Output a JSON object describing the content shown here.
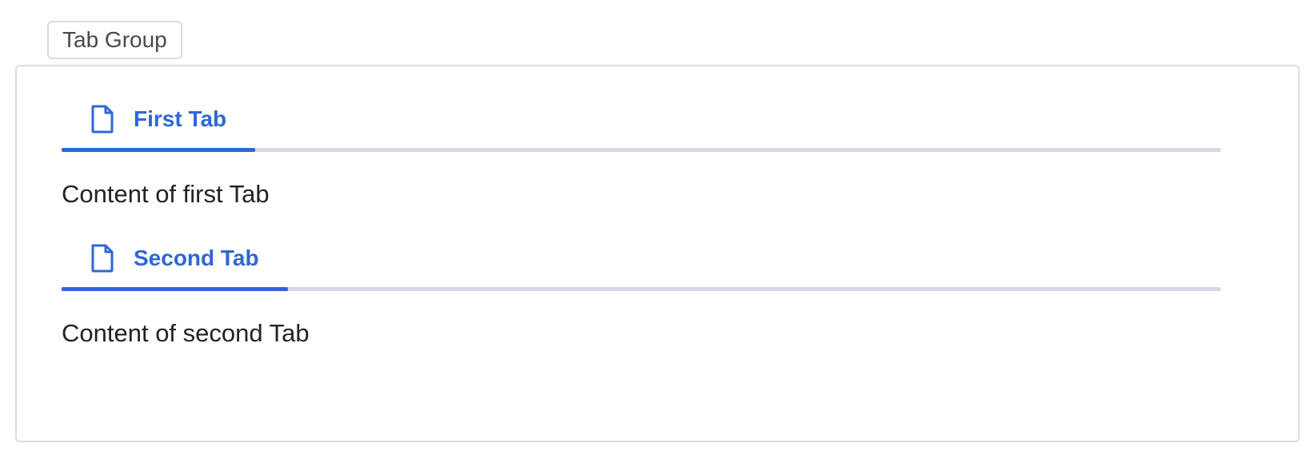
{
  "group": {
    "label": "Tab Group"
  },
  "tabs": [
    {
      "label": "First Tab",
      "icon": "file-icon",
      "content": "Content of first Tab",
      "active": true
    },
    {
      "label": "Second Tab",
      "icon": "file-icon",
      "content": "Content of second Tab",
      "active": true
    }
  ],
  "colors": {
    "accent": "#2f67d3",
    "track": "#d2d9e2",
    "border": "#dcdcdc",
    "text": "#222222"
  }
}
